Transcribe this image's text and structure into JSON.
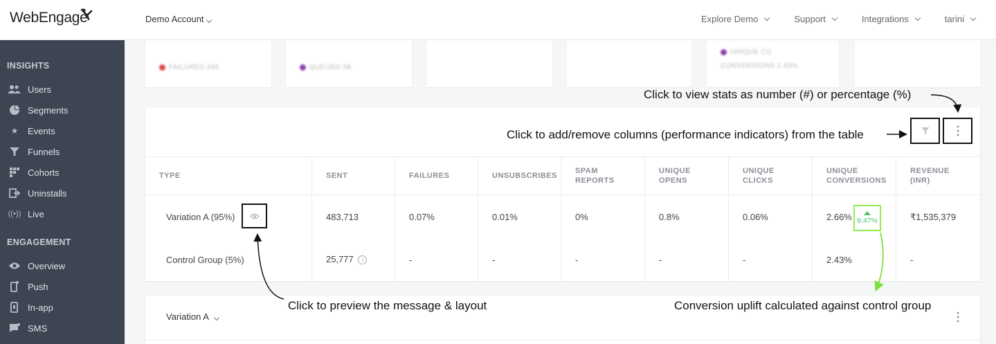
{
  "header": {
    "logo_text": "WebEngage",
    "account": "Demo Account",
    "nav": [
      "Explore Demo",
      "Support",
      "Integrations",
      "tarini"
    ]
  },
  "sidebar": {
    "insights_title": "INSIGHTS",
    "insights": [
      {
        "label": "Users",
        "icon": "users-icon"
      },
      {
        "label": "Segments",
        "icon": "pie-icon"
      },
      {
        "label": "Events",
        "icon": "star-icon"
      },
      {
        "label": "Funnels",
        "icon": "funnel-icon"
      },
      {
        "label": "Cohorts",
        "icon": "grid-icon"
      },
      {
        "label": "Uninstalls",
        "icon": "exit-icon"
      },
      {
        "label": "Live",
        "icon": "broadcast-icon"
      }
    ],
    "engagement_title": "ENGAGEMENT",
    "engagement": [
      {
        "label": "Overview",
        "icon": "eye-icon"
      },
      {
        "label": "Push",
        "icon": "phone-icon"
      },
      {
        "label": "In-app",
        "icon": "tablet-icon"
      },
      {
        "label": "SMS",
        "icon": "chat-icon"
      }
    ]
  },
  "stat_cards": [
    {
      "label": "FAILURES 345",
      "color": "#e04a4a"
    },
    {
      "label": "QUEUED 58",
      "color": "#8e44ad"
    },
    {
      "label": "",
      "color": ""
    },
    {
      "label": "",
      "color": ""
    },
    {
      "label": "UNIQUE CG CONVERSIONS 2.43%",
      "color": "#8e44ad"
    },
    {
      "label": "",
      "color": ""
    }
  ],
  "table": {
    "columns": [
      "TYPE",
      "SENT",
      "FAILURES",
      "UNSUBSCRIBES",
      "SPAM REPORTS",
      "UNIQUE OPENS",
      "UNIQUE CLICKS",
      "UNIQUE CONVERSIONS",
      "REVENUE (INR)"
    ],
    "rows": [
      [
        "Variation A (95%)",
        "483,713",
        "0.07%",
        "0.01%",
        "0%",
        "0.8%",
        "0.06%",
        "2.66%",
        "₹1,535,379"
      ],
      [
        "Control Group (5%)",
        "25,777",
        "-",
        "-",
        "-",
        "-",
        "-",
        "2.43%",
        "-"
      ]
    ],
    "uplift": "9.47%",
    "uplift_color": "#4cc46b"
  },
  "variation_panel": {
    "label": "Variation A"
  },
  "annotations": {
    "stats_toggle": "Click to view stats as number (#) or percentage (%)",
    "columns_toggle": "Click to add/remove columns (performance indicators) from the table",
    "preview": "Click to preview the message & layout",
    "uplift": "Conversion uplift calculated against control group"
  }
}
